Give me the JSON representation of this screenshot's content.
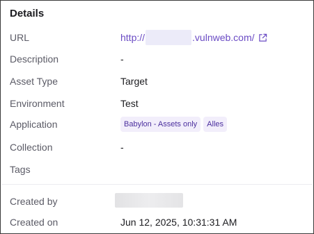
{
  "panel": {
    "title": "Details"
  },
  "fields": {
    "url": {
      "label": "URL",
      "prefix": "http://",
      "suffix": ".vulnweb.com/",
      "icon": "external-link-icon"
    },
    "description": {
      "label": "Description",
      "value": "-"
    },
    "asset_type": {
      "label": "Asset Type",
      "value": "Target"
    },
    "environment": {
      "label": "Environment",
      "value": "Test"
    },
    "application": {
      "label": "Application",
      "tags": [
        "Babylon - Assets only",
        "Alles"
      ]
    },
    "collection": {
      "label": "Collection",
      "value": "-"
    },
    "tags": {
      "label": "Tags",
      "value": ""
    }
  },
  "meta": {
    "created_by": {
      "label": "Created by",
      "value": ""
    },
    "created_on": {
      "label": "Created on",
      "value": "Jun 12, 2025, 10:31:31 AM"
    }
  },
  "colors": {
    "accent": "#6a4bc4",
    "tag_bg": "#f2eefb",
    "tag_text": "#4b2f9e",
    "label_text": "#5b5b66"
  }
}
